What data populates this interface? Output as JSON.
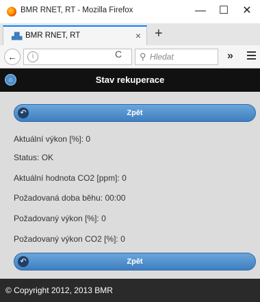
{
  "window": {
    "title": "BMR RNET, RT - Mozilla Firefox",
    "minimize": "—",
    "maximize": "☐",
    "close": "✕"
  },
  "tab": {
    "label": "BMR RNET, RT",
    "close": "×",
    "new_tab": "+"
  },
  "navbar": {
    "back": "←",
    "info": "i",
    "reload": "C",
    "search_placeholder": "Hledat",
    "overflow": "»"
  },
  "page": {
    "title": "Stav rekuperace",
    "back_button_top": "Zpět",
    "back_button_bottom": "Zpět",
    "fields": [
      "Aktuální výkon [%]: 0",
      "Status: OK",
      "Aktuální hodnota CO2 [ppm]: 0",
      "Požadovaná doba běhu: 00:00",
      "Požadovaný výkon [%]: 0",
      "Požadovaný výkon CO2 [%]: 0"
    ],
    "footer": "© Copyright 2012, 2013 BMR"
  },
  "icons": {
    "firefox": "firefox-icon",
    "favicon": "site-favicon-icon",
    "info": "info-icon",
    "search": "search-icon",
    "menu": "hamburger-menu-icon",
    "home": "home-icon",
    "back": "back-arrow-icon"
  }
}
